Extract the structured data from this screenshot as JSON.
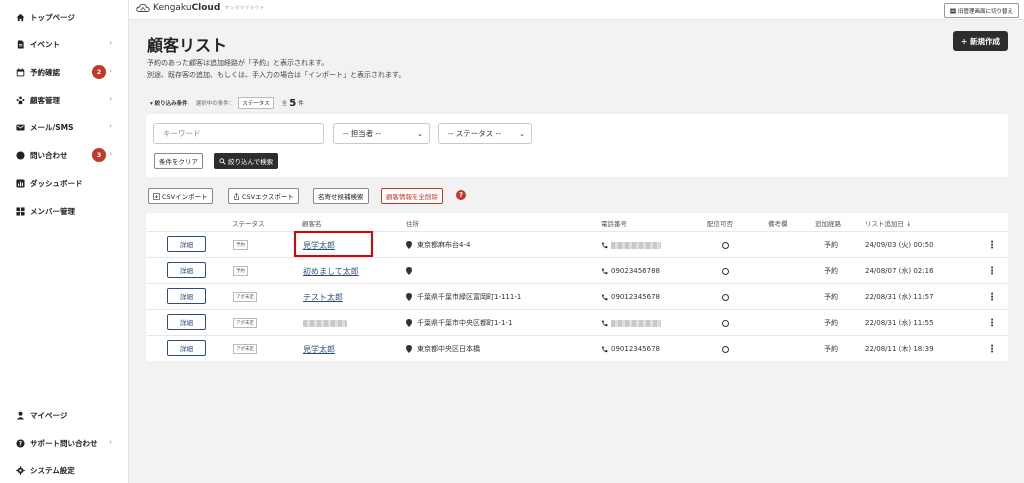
{
  "sidebar": {
    "items": [
      {
        "label": "トップページ",
        "icon": "home-icon",
        "chevron": ""
      },
      {
        "label": "イベント",
        "icon": "document-icon",
        "chevron": "›"
      },
      {
        "label": "予約確認",
        "icon": "calendar-icon",
        "chevron": "›",
        "badge": "2"
      },
      {
        "label": "顧客管理",
        "icon": "users-icon",
        "chevron": "›"
      },
      {
        "label": "メール/SMS",
        "icon": "mail-icon",
        "chevron": "›"
      },
      {
        "label": "問い合わせ",
        "icon": "chat-icon",
        "chevron": "›",
        "badge": "3"
      },
      {
        "label": "ダッシュボード",
        "icon": "chart-icon",
        "chevron": ""
      },
      {
        "label": "メンバー管理",
        "icon": "grid-icon",
        "chevron": ""
      }
    ],
    "bottom": [
      {
        "label": "マイページ",
        "icon": "person-icon",
        "chevron": ""
      },
      {
        "label": "サポート問い合わせ",
        "icon": "help-icon",
        "chevron": "›"
      },
      {
        "label": "システム設定",
        "icon": "gear-icon",
        "chevron": ""
      }
    ]
  },
  "header": {
    "logo_prefix": "Kengaku",
    "logo_bold": "Cloud",
    "logo_sub": "ケンガククラウド",
    "switch_label": "旧管理画面に切り替え"
  },
  "main": {
    "title": "顧客リスト",
    "desc1": "予約のあった顧客は追加経路が「予約」と表示されます。",
    "desc2": "別途、既存客の追加、もしくは、手入力の場合は「インポート」と表示されます。",
    "new_button": "+ 新規作成"
  },
  "filter": {
    "label": "▾ 絞り込み条件",
    "cond_label": "選択中の条件：",
    "chip": "ステータス",
    "total_prefix": "全",
    "total_count": "5",
    "total_suffix": "件",
    "keyword_placeholder": "キーワード",
    "assignee": "-- 担当者 --",
    "status": "-- ステータス --",
    "clear": "条件をクリア",
    "search": "絞り込んで検索"
  },
  "actions": {
    "csv_import": "CSVインポート",
    "csv_export": "CSVエクスポート",
    "namecard": "名寄せ候補検索",
    "delete_all": "顧客情報を全削除",
    "help": "?"
  },
  "table": {
    "headers": {
      "status": "ステータス",
      "name": "顧客名",
      "address": "住所",
      "phone": "電話番号",
      "delivery": "配信可否",
      "notes": "備考欄",
      "route": "追加経路",
      "added": "リスト追加日 ↓"
    },
    "detail_label": "詳細",
    "rows": [
      {
        "status": "予約",
        "name": "見学太郎",
        "address": "東京都麻布台4-4",
        "phone": "",
        "delivery": "○",
        "route": "予約",
        "added": "24/09/03 (火) 00:50"
      },
      {
        "status": "予約",
        "name": "初めまして太郎",
        "address": "",
        "phone": "09023456788",
        "delivery": "○",
        "route": "予約",
        "added": "24/08/07 (水) 02:16"
      },
      {
        "status": "アポ未定",
        "name": "テスト太郎",
        "address": "千葉県千葉市緑区富岡町1-111-1",
        "phone": "09012345678",
        "delivery": "○",
        "route": "予約",
        "added": "22/08/31 (水) 11:57"
      },
      {
        "status": "アポ未定",
        "name": "",
        "address": "千葉県千葉市中央区都町1-1-1",
        "phone": "",
        "delivery": "○",
        "route": "予約",
        "added": "22/08/31 (水) 11:55"
      },
      {
        "status": "アポ未定",
        "name": "見学太郎",
        "address": "東京都中央区日本橋",
        "phone": "09012345678",
        "delivery": "○",
        "route": "予約",
        "added": "22/08/11 (木) 18:39"
      }
    ]
  },
  "colors": {
    "accent": "#2c4d7a",
    "danger": "#c0392b",
    "dark": "#2d2d2d"
  }
}
